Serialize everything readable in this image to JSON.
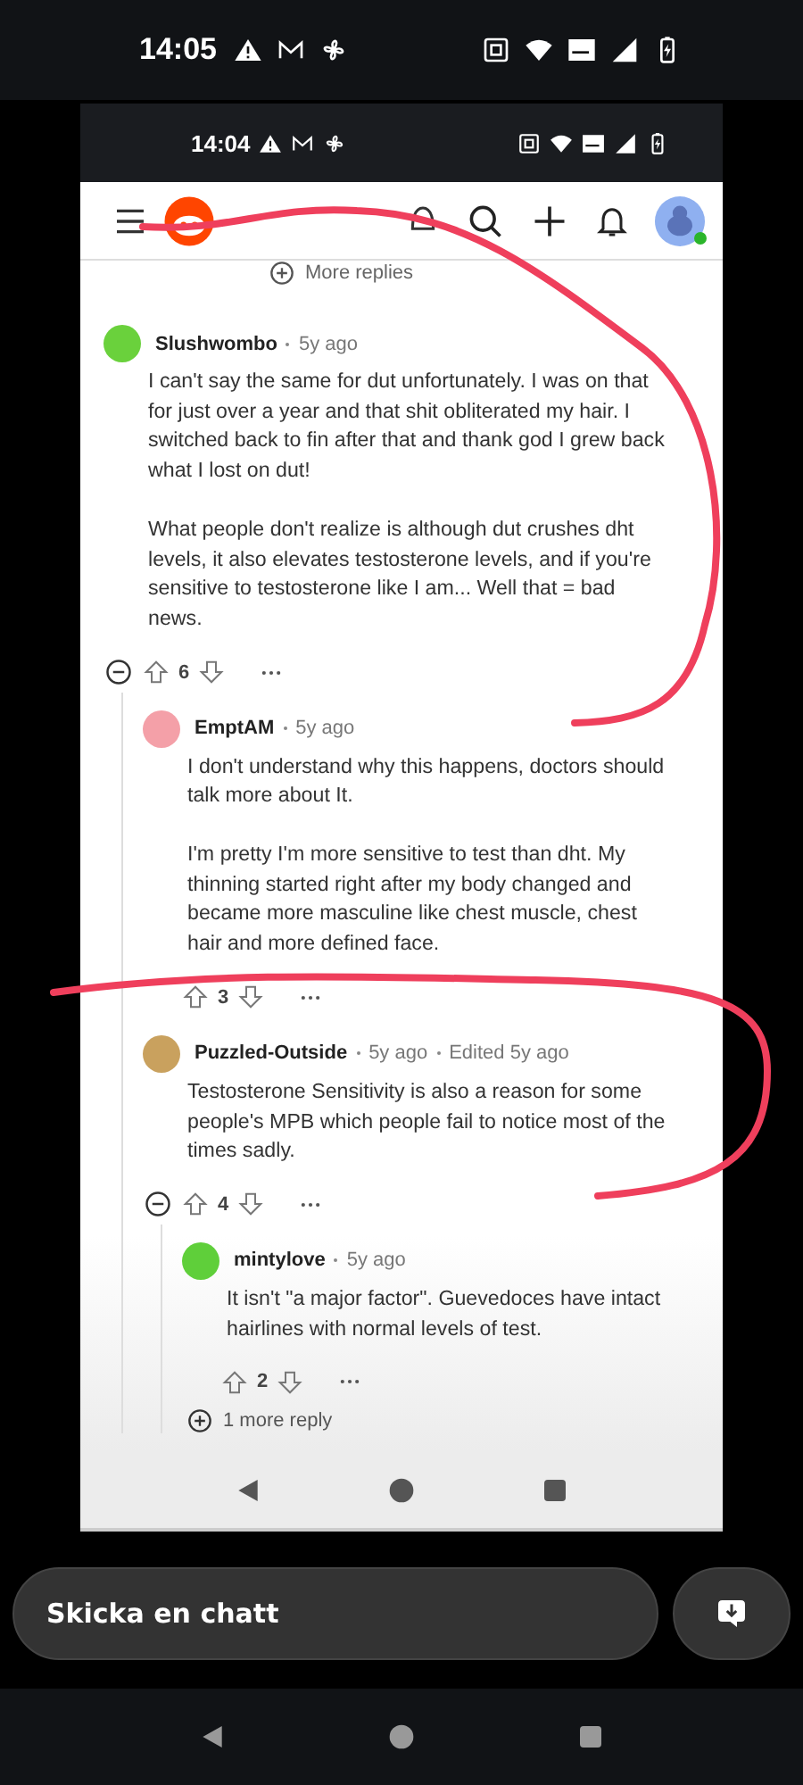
{
  "status_bar": {
    "time": "14:05"
  },
  "screenshot": {
    "status_bar": {
      "time": "14:04"
    },
    "more_replies": "More replies",
    "comments": [
      {
        "author": "Slushwombo",
        "age": "5y ago",
        "color": "#6ad13c",
        "body": [
          "I can't say the same for dut unfortunately. I was on that for just over a year and that shit obliterated my hair. I switched back to fin after that and thank god I grew back what I lost on dut!",
          "What people don't realize is although dut crushes dht levels, it also elevates testosterone levels, and if you're sensitive to testosterone like I am... Well that = bad news."
        ],
        "votes": "6",
        "children": [
          {
            "author": "EmptAM",
            "age": "5y ago",
            "color": "#f4a0a8",
            "body": [
              "I don't understand why this happens, doctors should talk more about It.",
              "I'm pretty I'm more sensitive to test than dht. My thinning started right after my body changed and became more masculine like chest muscle, chest hair and more defined face."
            ],
            "votes": "3"
          },
          {
            "author": "Puzzled-Outside",
            "age": "5y ago",
            "edited": "Edited 5y ago",
            "color": "#c9a15e",
            "body": [
              "Testosterone Sensitivity is also a reason for some people's MPB which people fail to notice most of the times sadly."
            ],
            "votes": "4",
            "children": [
              {
                "author": "mintylove",
                "age": "5y ago",
                "color": "#5fcf3a",
                "body": [
                  "It isn't \"a major factor\". Guevedoces have intact hairlines with normal levels of test."
                ],
                "votes": "2",
                "more": "1 more reply"
              }
            ]
          }
        ]
      }
    ]
  },
  "chat": {
    "placeholder": "Skicka en chatt"
  }
}
